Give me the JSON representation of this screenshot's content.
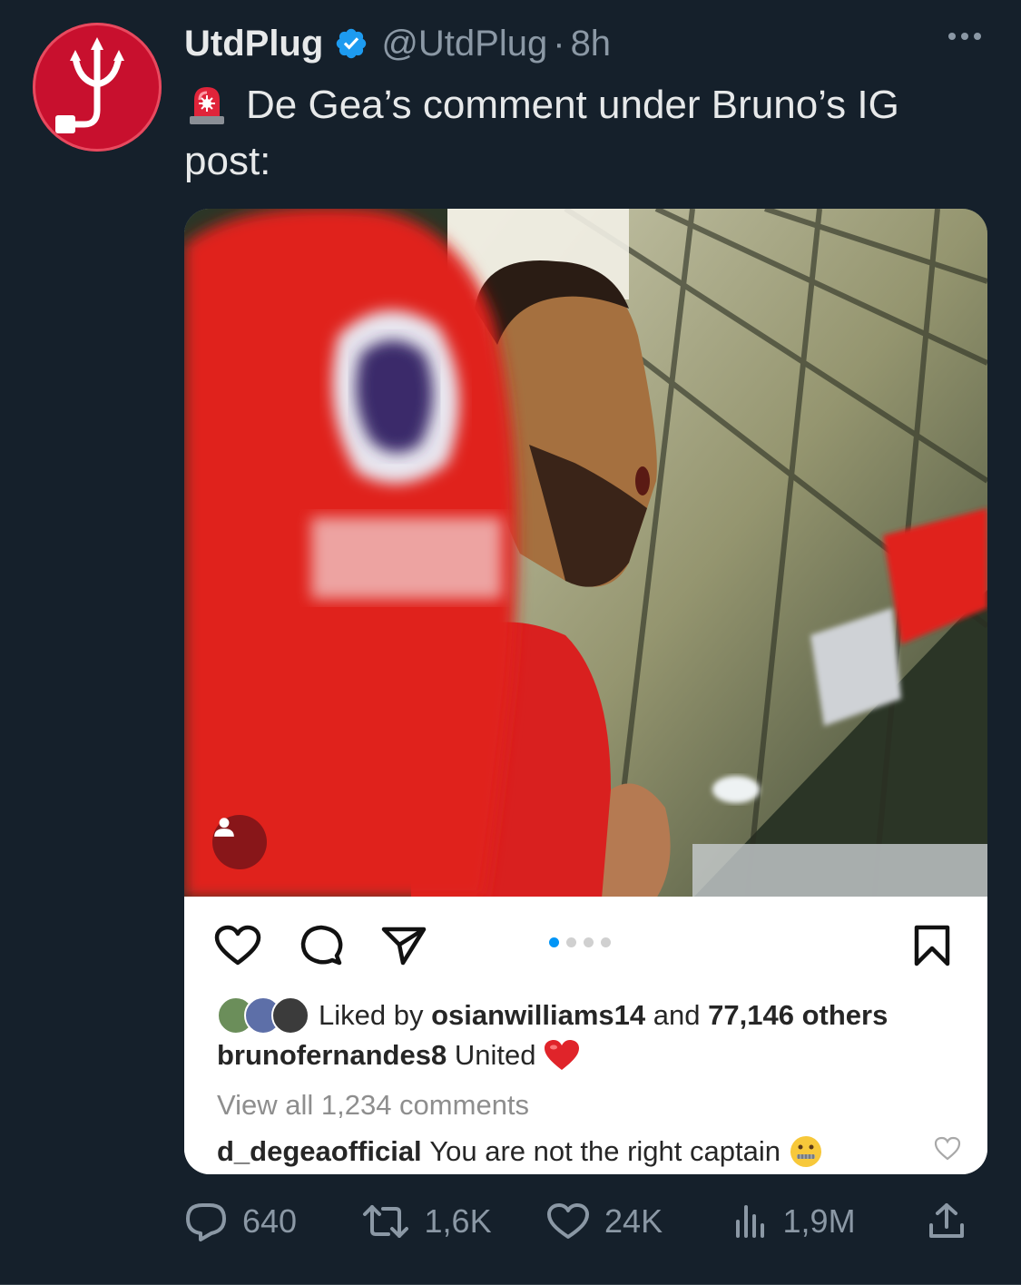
{
  "author": {
    "name": "UtdPlug",
    "handle": "@UtdPlug",
    "separator": "·",
    "time": "8h"
  },
  "tweet": {
    "text": "De Gea’s comment under Bruno’s IG post:"
  },
  "instagram": {
    "liked_prefix": "Liked by",
    "liked_user": "osianwilliams14",
    "liked_and": "and",
    "liked_others": "77,146 others",
    "caption_user": "brunofernandes8",
    "caption_text": "United",
    "caption_emoji": "❤️",
    "view_all": "View all 1,234 comments",
    "comment_user": "d_degeaofficial",
    "comment_text": "You are not the right captain",
    "comment_emoji": "🤐",
    "carousel_total": 4,
    "carousel_active": 1
  },
  "metrics": {
    "replies": "640",
    "retweets": "1,6K",
    "likes": "24K",
    "views": "1,9M"
  },
  "colors": {
    "background": "#15202b",
    "verified": "#1d9bf0",
    "ig_blue": "#0095f6",
    "brand_red": "#c8102e"
  }
}
